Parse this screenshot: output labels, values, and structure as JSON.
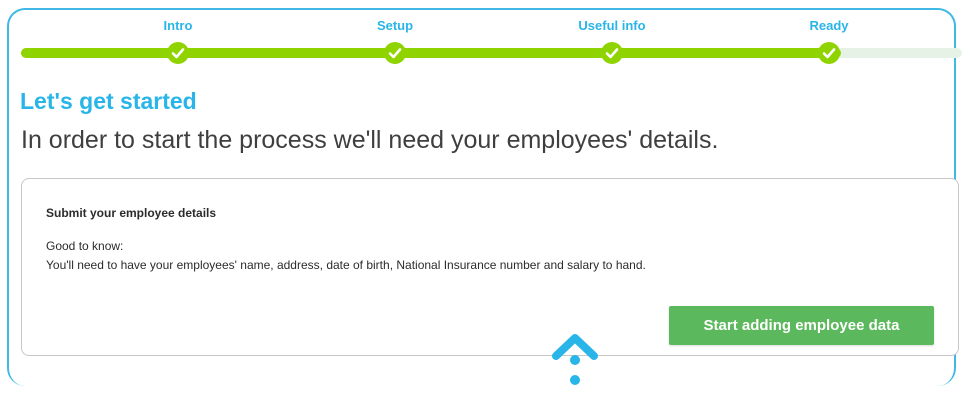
{
  "progress": {
    "steps": [
      {
        "label": "Intro"
      },
      {
        "label": "Setup"
      },
      {
        "label": "Useful info"
      },
      {
        "label": "Ready"
      }
    ],
    "completed_steps": 4,
    "fraction_complete": 0.87
  },
  "page": {
    "title": "Let's get started",
    "subtitle": "In order to start the process we'll need your employees' details."
  },
  "card": {
    "title": "Submit your employee details",
    "good_to_know": "Good to know:",
    "text": "You'll need to have your employees' name, address, date of birth, National Insurance number and salary to hand.",
    "button_label": "Start adding employee data"
  },
  "colors": {
    "accent_blue": "#29b5e8",
    "progress_green": "#8fd400",
    "button_green": "#5cb85c"
  },
  "icons": {
    "step_check": "check-icon",
    "floating": "chevron-up-icon"
  }
}
